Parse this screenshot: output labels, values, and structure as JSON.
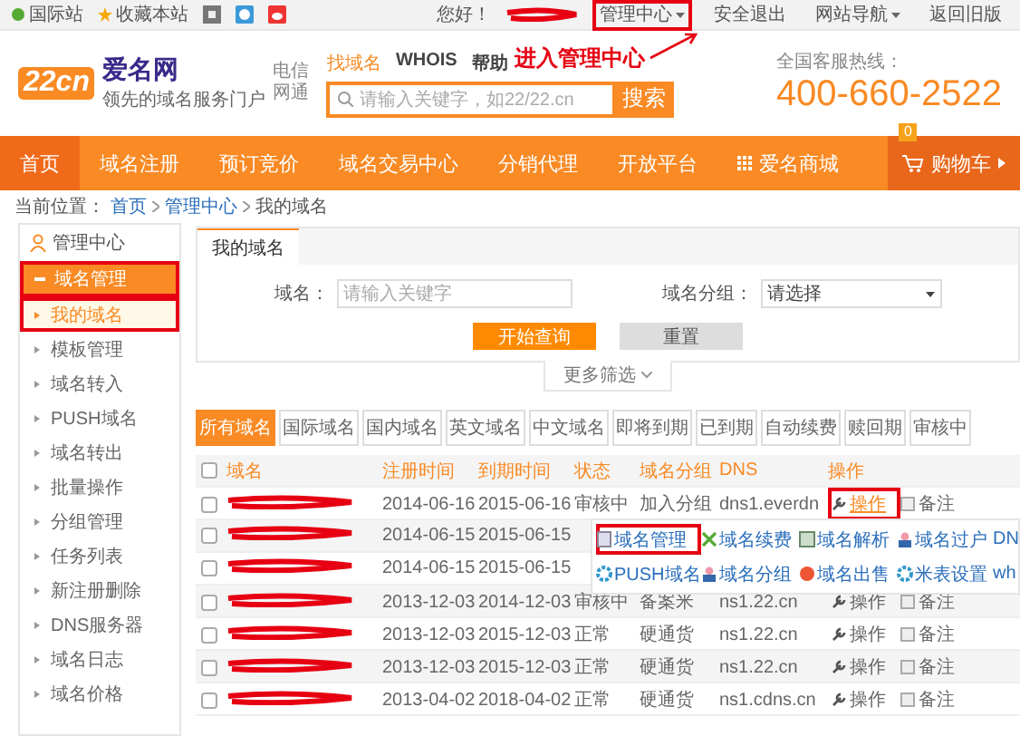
{
  "top_bar": {
    "left_links": [
      "国际站",
      "收藏本站"
    ],
    "greeting": "您好！",
    "user_redacted": true,
    "right_links": [
      {
        "label": "管理中心",
        "dropdown": true,
        "annotated": true
      },
      {
        "label": "安全退出",
        "dropdown": false,
        "annotated": false
      },
      {
        "label": "网站导航",
        "dropdown": true,
        "annotated": false
      },
      {
        "label": "返回旧版",
        "dropdown": false,
        "annotated": false
      }
    ]
  },
  "header": {
    "logo": {
      "mark": "22cn",
      "name": "爱名网",
      "slogan": "领先的域名服务门户",
      "networks": [
        "电信",
        "网通"
      ]
    },
    "search_tabs": [
      {
        "label": "找域名",
        "selected": true
      },
      {
        "label": "WHOIS",
        "selected": false
      },
      {
        "label": "帮助",
        "selected": false
      }
    ],
    "search": {
      "placeholder": "请输入关键字，如22/22.cn",
      "button": "搜索"
    },
    "hotline": {
      "label": "全国客服热线：",
      "number": "400-660-2522"
    },
    "callout": "进入管理中心"
  },
  "nav": {
    "items": [
      {
        "label": "首页",
        "selected": true
      },
      {
        "label": "域名注册",
        "selected": false
      },
      {
        "label": "预订竞价",
        "selected": false
      },
      {
        "label": "域名交易中心",
        "selected": false
      },
      {
        "label": "分销代理",
        "selected": false
      },
      {
        "label": "开放平台",
        "selected": false
      },
      {
        "label": "爱名商城",
        "selected": false
      }
    ],
    "cart": {
      "label": "购物车",
      "count": "0"
    }
  },
  "breadcrumb": {
    "prefix": "当前位置：",
    "links": [
      "首页",
      "管理中心"
    ],
    "current": "我的域名"
  },
  "sidebar": {
    "title": "管理中心",
    "group": {
      "label": "域名管理",
      "expanded": true,
      "annotated": true,
      "items": [
        {
          "label": "我的域名",
          "selected": true,
          "annotated": true
        },
        {
          "label": "模板管理",
          "selected": false,
          "annotated": false
        },
        {
          "label": "域名转入",
          "selected": false,
          "annotated": false
        },
        {
          "label": "PUSH域名",
          "selected": false,
          "annotated": false
        },
        {
          "label": "域名转出",
          "selected": false,
          "annotated": false
        },
        {
          "label": "批量操作",
          "selected": false,
          "annotated": false
        },
        {
          "label": "分组管理",
          "selected": false,
          "annotated": false
        },
        {
          "label": "任务列表",
          "selected": false,
          "annotated": false
        },
        {
          "label": "新注册删除",
          "selected": false,
          "annotated": false
        },
        {
          "label": "DNS服务器",
          "selected": false,
          "annotated": false
        },
        {
          "label": "域名日志",
          "selected": false,
          "annotated": false
        },
        {
          "label": "域名价格",
          "selected": false,
          "annotated": false
        }
      ]
    }
  },
  "panel": {
    "tab": "我的域名",
    "filters": {
      "domain_label": "域名：",
      "domain_placeholder": "请输入关键字",
      "group_label": "域名分组：",
      "group_value": "请选择",
      "search_button": "开始查询",
      "reset_button": "重置",
      "more": "更多筛选"
    },
    "categories": [
      {
        "label": "所有域名",
        "selected": true
      },
      {
        "label": "国际域名",
        "selected": false
      },
      {
        "label": "国内域名",
        "selected": false
      },
      {
        "label": "英文域名",
        "selected": false
      },
      {
        "label": "中文域名",
        "selected": false
      },
      {
        "label": "即将到期",
        "selected": false
      },
      {
        "label": "已到期",
        "selected": false
      },
      {
        "label": "自动续费",
        "selected": false
      },
      {
        "label": "赎回期",
        "selected": false
      },
      {
        "label": "审核中",
        "selected": false
      }
    ],
    "table": {
      "select_all_checked": false,
      "columns": [
        "域名",
        "注册时间",
        "到期时间",
        "状态",
        "域名分组",
        "DNS",
        "操作"
      ],
      "rows": [
        {
          "checked": false,
          "domain_redacted": true,
          "registered": "2014-06-16",
          "expires": "2015-06-16",
          "status": "审核中",
          "group": "加入分组",
          "dns": "dns1.everdn",
          "action": "操作",
          "note": "备注",
          "action_open": true,
          "annotated": true
        },
        {
          "checked": false,
          "domain_redacted": true,
          "registered": "2014-06-15",
          "expires": "2015-06-15"
        },
        {
          "checked": false,
          "domain_redacted": true,
          "registered": "2014-06-15",
          "expires": "2015-06-15"
        },
        {
          "checked": false,
          "domain_redacted": true,
          "registered": "2013-12-03",
          "expires": "2014-12-03",
          "status": "审核中",
          "group": "备案米",
          "dns": "ns1.22.cn",
          "action": "操作",
          "note": "备注",
          "action_open": false,
          "annotated": false
        },
        {
          "checked": false,
          "domain_redacted": true,
          "registered": "2013-12-03",
          "expires": "2015-12-03",
          "status": "正常",
          "group": "硬通货",
          "dns": "ns1.22.cn",
          "action": "操作",
          "note": "备注",
          "action_open": false,
          "annotated": false
        },
        {
          "checked": false,
          "domain_redacted": true,
          "registered": "2013-12-03",
          "expires": "2015-12-03",
          "status": "正常",
          "group": "硬通货",
          "dns": "ns1.22.cn",
          "action": "操作",
          "note": "备注",
          "action_open": false,
          "annotated": false
        },
        {
          "checked": false,
          "domain_redacted": true,
          "registered": "2013-04-02",
          "expires": "2018-04-02",
          "status": "正常",
          "group": "硬通货",
          "dns": "ns1.cdns.cn",
          "action": "操作",
          "note": "备注",
          "action_open": false,
          "annotated": false
        }
      ]
    },
    "action_menu": [
      {
        "label": "域名管理",
        "kind": "page",
        "annotated": true
      },
      {
        "label": "域名续费",
        "kind": "renew",
        "annotated": false
      },
      {
        "label": "域名解析",
        "kind": "dns",
        "annotated": false
      },
      {
        "label": "域名过户",
        "kind": "user",
        "annotated": false
      },
      {
        "label": "DN",
        "kind": "text",
        "annotated": false
      },
      {
        "label": "PUSH域名",
        "kind": "gear",
        "annotated": false
      },
      {
        "label": "域名分组",
        "kind": "user",
        "annotated": false
      },
      {
        "label": "域名出售",
        "kind": "sale",
        "annotated": false
      },
      {
        "label": "米表设置",
        "kind": "gear",
        "annotated": false
      },
      {
        "label": "wh",
        "kind": "text",
        "annotated": false
      }
    ]
  }
}
